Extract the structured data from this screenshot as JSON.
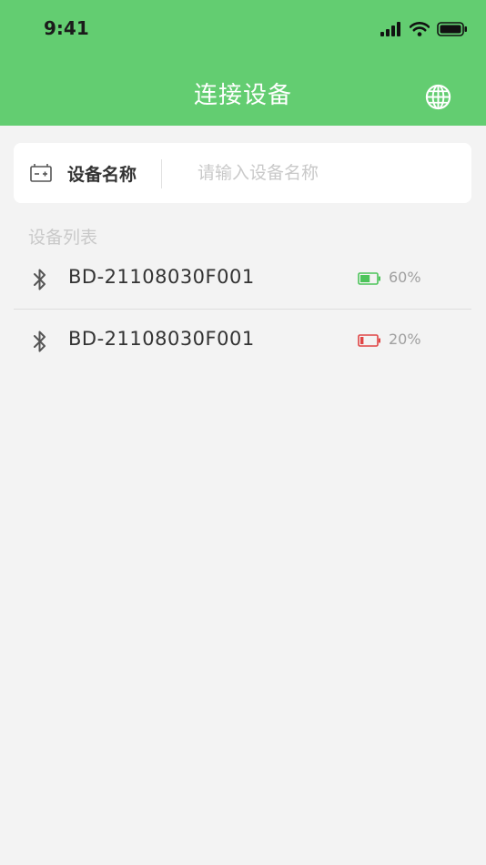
{
  "status_bar": {
    "time": "9:41",
    "signal_icon": "cellular-signal-icon",
    "wifi_icon": "wifi-icon",
    "battery_icon": "status-battery-icon"
  },
  "header": {
    "title": "连接设备",
    "globe_icon": "globe-icon",
    "background_color": "#63cd71"
  },
  "search": {
    "icon": "device-battery-icon",
    "label": "设备名称",
    "placeholder": "请输入设备名称",
    "value": ""
  },
  "device_list": {
    "title": "设备列表",
    "items": [
      {
        "name": "BD-21108030F001",
        "battery_text": "60%",
        "battery_level": 0.6,
        "battery_color": "#4cc45a",
        "icon": "bluetooth-icon"
      },
      {
        "name": "BD-21108030F001",
        "battery_text": "20%",
        "battery_level": 0.2,
        "battery_color": "#e04545",
        "icon": "bluetooth-icon"
      }
    ]
  }
}
